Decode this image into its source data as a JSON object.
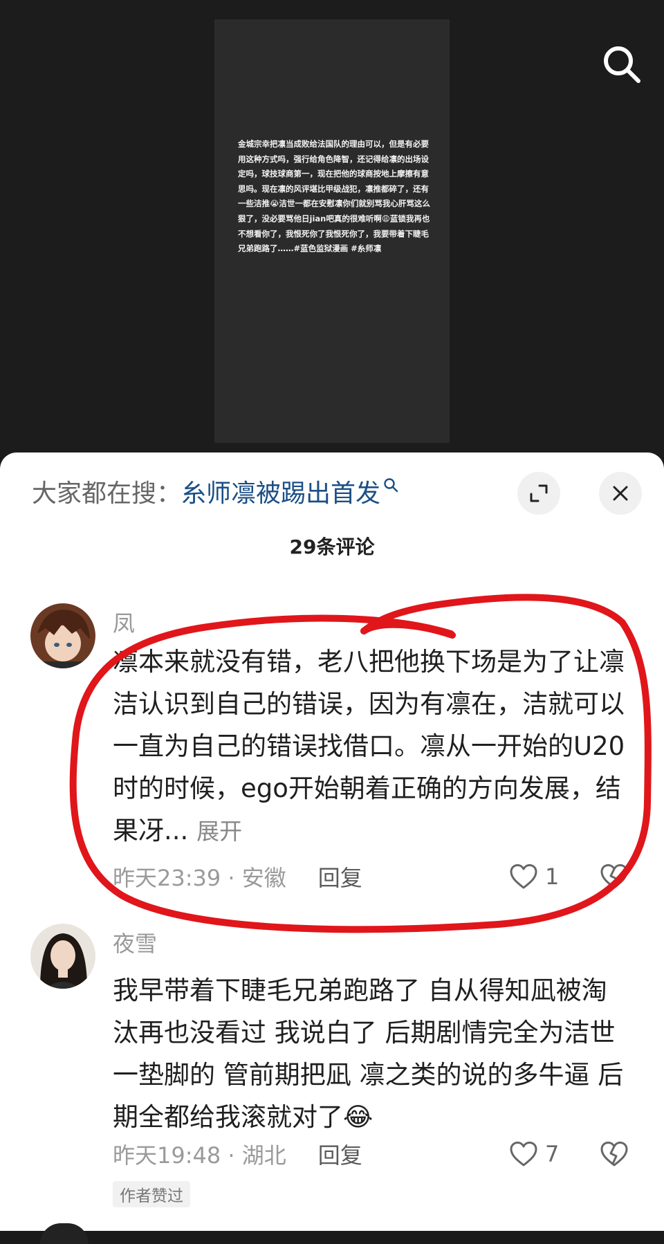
{
  "video": {
    "post_text": "金城宗幸把凛当成败给法国队的理由可以，但是有必要用这种方式吗，强行给角色降智，还记得给凛的出场设定吗，球技球商第一，现在把他的球商按地上摩擦有意思吗。现在凛的风评堪比甲级战犯，凛推都碎了，还有一些洁推😭洁世一都在安慰凛你们就别骂我心肝骂这么狠了，没必要骂他日jian吧真的很难听啊😩蓝锁我再也不想看你了，我恨死你了我恨死你了，我要带着下睫毛兄弟跑路了……#蓝色监狱漫画 #糸师凛"
  },
  "search_bar": {
    "prefix": "大家都在搜：",
    "term": "糸师凛被踢出首发"
  },
  "comments_header": {
    "count_label": "29条评论"
  },
  "comments": [
    {
      "username": "凤",
      "text": "凛本来就没有错，老八把他换下场是为了让凛洁认识到自己的错误，因为有凛在，洁就可以一直为自己的错误找借口。凛从一开始的U20时的时候，ego开始朝着正确的方向发展，结果冴...",
      "expand_label": "展开",
      "time_location": "昨天23:39 · 安徽",
      "reply_label": "回复",
      "likes": "1"
    },
    {
      "username": "夜雪",
      "text": "我早带着下睫毛兄弟跑路了 自从得知凪被淘汰再也没看过 我说白了 后期剧情完全为洁世一垫脚的 管前期把凪 凛之类的说的多牛逼 后期全都给我滚就对了😂",
      "time_location": "昨天19:48 · 湖北",
      "reply_label": "回复",
      "likes": "7",
      "badge": "作者赞过"
    }
  ],
  "colors": {
    "annotation_circle": "#e0161b",
    "link_blue": "#1b4f86"
  },
  "icons": [
    "search-icon",
    "expand-icon",
    "close-icon",
    "heart-icon",
    "dislike-heart-icon"
  ]
}
